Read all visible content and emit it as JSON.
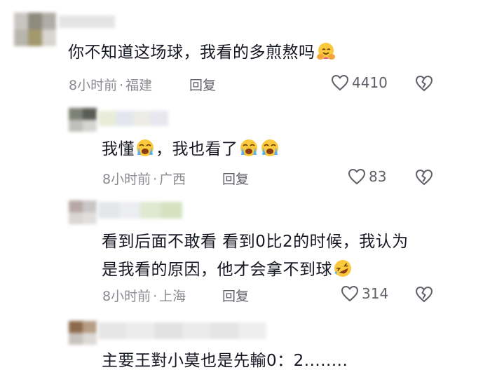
{
  "icons": {
    "like": "heart-outline-icon",
    "dislike": "broken-heart-outline-icon",
    "hug": "hugging-face-emoji",
    "cry": "loudly-crying-face-emoji",
    "laugh": "rolling-on-floor-laughing-emoji"
  },
  "colors": {
    "text": "#161823",
    "meta": "#8a8b91",
    "action": "#5f6067"
  },
  "comments": [
    {
      "text": "你不知道这场球，我看的多煎熬吗",
      "time": "8小时前",
      "sep": "·",
      "location": "福建",
      "reply": "回复",
      "likes": "4410"
    },
    {
      "text_a": "我懂",
      "text_b": "，我也看了",
      "time": "8小时前",
      "sep": "·",
      "location": "广西",
      "reply": "回复",
      "likes": "83"
    },
    {
      "line1": "看到后面不敢看 看到0比2的时候，我认为",
      "line2": "是我看的原因，他才会拿不到球",
      "time": "8小时前",
      "sep": "·",
      "location": "上海",
      "reply": "回复",
      "likes": "314"
    },
    {
      "text": "主要王對小莫也是先輸0：2........"
    }
  ]
}
